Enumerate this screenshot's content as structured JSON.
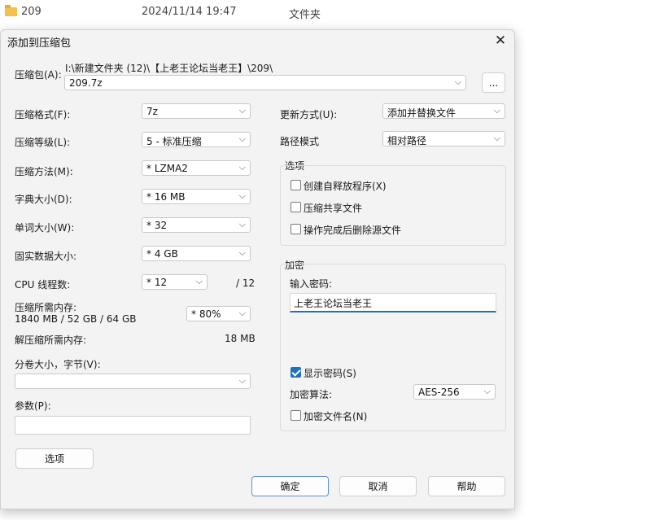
{
  "background": {
    "row1": {
      "name": "209",
      "date": "2024/11/14 19:47",
      "type": "文件夹"
    }
  },
  "dialog": {
    "title": "添加到压缩包",
    "close_glyph": "✕",
    "archive": {
      "label": "压缩包(A):",
      "path": "I:\\新建文件夹 (12)\\【上老王论坛当老王】\\209\\",
      "value": "209.7z",
      "browse_label": "..."
    },
    "left": {
      "format": {
        "label": "压缩格式(F):",
        "value": "7z"
      },
      "level": {
        "label": "压缩等级(L):",
        "value": "5 - 标准压缩"
      },
      "method": {
        "label": "压缩方法(M):",
        "value": "* LZMA2"
      },
      "dict": {
        "label": "字典大小(D):",
        "value": "* 16 MB"
      },
      "word": {
        "label": "单词大小(W):",
        "value": "* 32"
      },
      "solid": {
        "label": "固实数据大小:",
        "value": "* 4 GB"
      },
      "threads": {
        "label": "CPU 线程数:",
        "value": "* 12",
        "max": "/ 12"
      },
      "memory": {
        "label": "压缩所需内存:",
        "detail": "1840 MB / 52 GB / 64 GB",
        "value": "* 80%"
      },
      "decompress_memory": {
        "label": "解压缩所需内存:",
        "value": "18 MB"
      },
      "split": {
        "label": "分卷大小，字节(V):",
        "value": ""
      },
      "params": {
        "label": "参数(P):",
        "value": ""
      },
      "options_button": "选项"
    },
    "right": {
      "update": {
        "label": "更新方式(U):",
        "value": "添加并替换文件"
      },
      "path_mode": {
        "label": "路径模式",
        "value": "相对路径"
      },
      "options_group": {
        "title": "选项",
        "sfx": "创建自释放程序(X)",
        "shared": "压缩共享文件",
        "delete": "操作完成后删除源文件"
      },
      "encryption": {
        "title": "加密",
        "password_label": "输入密码:",
        "password_value": "上老王论坛当老王",
        "show_password": "显示密码(S)",
        "method_label": "加密算法:",
        "method_value": "AES-256",
        "encrypt_names": "加密文件名(N)"
      }
    },
    "buttons": {
      "ok": "确定",
      "cancel": "取消",
      "help": "帮助"
    }
  },
  "colors": {
    "accent": "#1f6fc2",
    "folder": "#f2c14e"
  }
}
